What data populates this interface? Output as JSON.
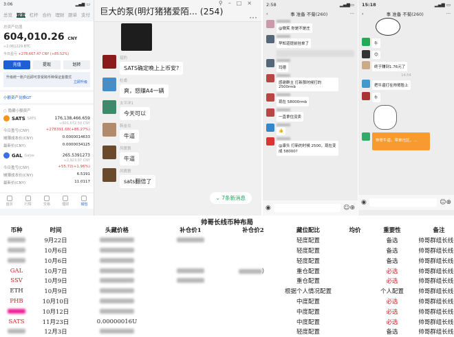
{
  "wallet": {
    "status_time": "3:06",
    "tabs": [
      "总览",
      "现货",
      "杠杆",
      "合约",
      "理财",
      "跟单",
      "支付"
    ],
    "active_tab": "现货",
    "total_label": "总资产估值",
    "total": "604,010.26",
    "currency": "CNY",
    "btc": "≈2.061229 BTC",
    "today_label": "今日盈亏",
    "today_pnl": "+278,667.47 CNY (+85.52%)",
    "buttons": [
      "充值",
      "提现",
      "划转"
    ],
    "notice": "升级统一账户后即可享受跨币种保证金模式",
    "notice_link": "立即升级",
    "small_assets": "小额资产兑换GT",
    "hide_small": "隐藏小额资产",
    "assets": [
      {
        "symbol": "SATS",
        "name": "SATS",
        "amount": "176,138,466.659",
        "value": "≈601,072.50 CNY",
        "pnl": "+278391.68(+86.27%)",
        "cost": "0.0000014633",
        "price": "0.0000034125",
        "color": "#f7931a"
      },
      {
        "symbol": "GAL",
        "name": "Galxe",
        "amount": "265.5391273",
        "value": "≈2,923.97 CNY",
        "pnl": "+55.72(+1.96%)",
        "cost": "6.5191",
        "price": "11.0117",
        "color": "#3b6ee8"
      }
    ],
    "labels": {
      "pnl": "今日盈亏(CNY)",
      "cost": "摊薄成本价(CNY)",
      "price": "最新价(CNY)"
    },
    "nav": [
      "首页",
      "行情",
      "交易",
      "理财",
      "钱包"
    ]
  },
  "group_chat": {
    "title": "巨大的泵(明灯猪猪爱陌...  (254)",
    "messages": [
      {
        "name": "猎豹",
        "text": "SATS确定晚上上币安?",
        "color": "#8b1a1a"
      },
      {
        "name": "杜甫",
        "text": "爽，怒赚A4一辆",
        "color": "#4a8cc4"
      },
      {
        "name": "太平洋1",
        "text": "今天可以",
        "color": "#3f8a6a"
      },
      {
        "name": "韩金兑",
        "text": "牛逼",
        "color": "#b08a6a"
      },
      {
        "name": "风蓑蓑",
        "text": "牛逼",
        "color": "#6a4a2a"
      },
      {
        "name": "风蓑蓑",
        "text": "sats翻倍了",
        "color": "#6a4a2a"
      }
    ],
    "new_messages": "7条新消息"
  },
  "mobile_chat_1": {
    "time": "2:58",
    "title": "事 准备 不菊(260)",
    "messages": [
      "@微笑 你是不是庄",
      "早知道提前挂单了",
      "玛德",
      "感谢群主 打新那时候打的2500rmb",
      "现在 58000rmb",
      "一直拿住没卖",
      "👍",
      "@康头 打新的时候 2500，现在变成 58000?"
    ]
  },
  "mobile_chat_2": {
    "time": "15:18",
    "title": "事 准备 不菊(260)",
    "messages": [
      "牛",
      "😊",
      "终于赚到1.76元了",
      "把牛逼打在帅哥脸上",
      "牛"
    ],
    "timestamp": "14:54",
    "red_packet": "帅哥牛逼，带单社区，..."
  },
  "table": {
    "title": "帅哥长线币种布局",
    "headers": [
      "币种",
      "时间",
      "头藏价格",
      "补仓价1",
      "补仓价2",
      "藏位配比",
      "均价",
      "重要性",
      "备注"
    ],
    "rows": [
      {
        "coin": "",
        "date": "9月22日",
        "price": "",
        "add1": "",
        "add2": "",
        "ratio": "轻度配置",
        "avg": "",
        "importance": "备选",
        "note": "帅哥群组长线币",
        "red": false
      },
      {
        "coin": "",
        "date": "10月6日",
        "price": "",
        "add1": "",
        "add2": "",
        "ratio": "轻度配置",
        "avg": "",
        "importance": "备选",
        "note": "帅哥群组长线币",
        "red": false
      },
      {
        "coin": "",
        "date": "10月6日",
        "price": "",
        "add1": "",
        "add2": "",
        "ratio": "轻度配置",
        "avg": "",
        "importance": "备选",
        "note": "帅哥群组长线币",
        "red": false
      },
      {
        "coin": "GAL",
        "date": "10月7日",
        "price": "",
        "add1": "",
        "add2": "）",
        "ratio": "重仓配置",
        "avg": "",
        "importance": "必选",
        "note": "帅哥群组长线币",
        "red": true
      },
      {
        "coin": "SSV",
        "date": "10月9日",
        "price": "",
        "add1": "",
        "add2": "",
        "ratio": "重仓配置",
        "avg": "",
        "importance": "必选",
        "note": "帅哥群组长线币",
        "red": true
      },
      {
        "coin": "ETH",
        "date": "10月9日",
        "price": "",
        "add1": "",
        "add2": "",
        "ratio": "根据个人情况配置",
        "avg": "",
        "importance": "个人配置",
        "note": "帅哥群组长线币",
        "red": false
      },
      {
        "coin": "PHB",
        "date": "10月10日",
        "price": "",
        "add1": "",
        "add2": "",
        "ratio": "中度配置",
        "avg": "",
        "importance": "必选",
        "note": "帅哥群组长线币",
        "red": true
      },
      {
        "coin": "",
        "date": "10月12日",
        "price": "",
        "add1": "",
        "add2": "",
        "ratio": "中度配置",
        "avg": "",
        "importance": "必选",
        "note": "帅哥群组长线币",
        "red": true
      },
      {
        "coin": "SATS",
        "date": "11月23日",
        "price": "0.00000016U",
        "add1": "",
        "add2": "",
        "ratio": "中度配置",
        "avg": "",
        "importance": "必选",
        "note": "帅哥群组长线币",
        "red": true
      },
      {
        "coin": "",
        "date": "12月3日",
        "price": "",
        "add1": "",
        "add2": "",
        "ratio": "轻度配置",
        "avg": "",
        "importance": "备选",
        "note": "帅哥群组长线币",
        "red": false
      }
    ]
  }
}
